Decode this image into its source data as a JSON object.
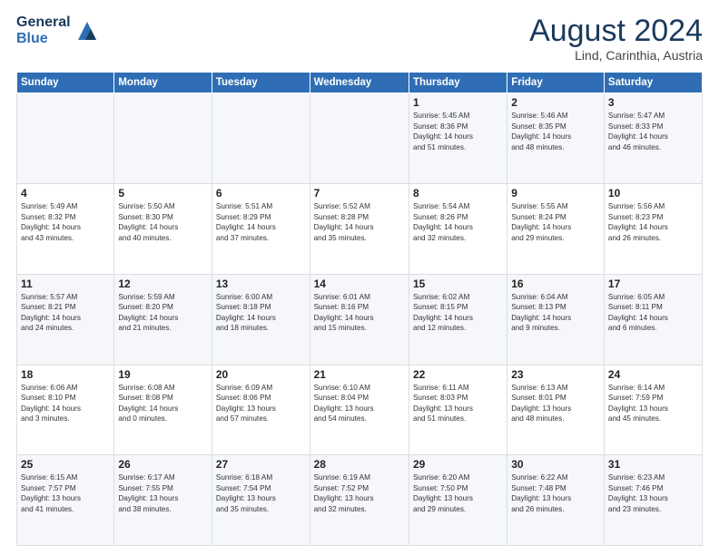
{
  "header": {
    "logo_line1": "General",
    "logo_line2": "Blue",
    "title": "August 2024",
    "subtitle": "Lind, Carinthia, Austria"
  },
  "weekdays": [
    "Sunday",
    "Monday",
    "Tuesday",
    "Wednesday",
    "Thursday",
    "Friday",
    "Saturday"
  ],
  "weeks": [
    [
      {
        "day": "",
        "content": ""
      },
      {
        "day": "",
        "content": ""
      },
      {
        "day": "",
        "content": ""
      },
      {
        "day": "",
        "content": ""
      },
      {
        "day": "1",
        "content": "Sunrise: 5:45 AM\nSunset: 8:36 PM\nDaylight: 14 hours\nand 51 minutes."
      },
      {
        "day": "2",
        "content": "Sunrise: 5:46 AM\nSunset: 8:35 PM\nDaylight: 14 hours\nand 48 minutes."
      },
      {
        "day": "3",
        "content": "Sunrise: 5:47 AM\nSunset: 8:33 PM\nDaylight: 14 hours\nand 46 minutes."
      }
    ],
    [
      {
        "day": "4",
        "content": "Sunrise: 5:49 AM\nSunset: 8:32 PM\nDaylight: 14 hours\nand 43 minutes."
      },
      {
        "day": "5",
        "content": "Sunrise: 5:50 AM\nSunset: 8:30 PM\nDaylight: 14 hours\nand 40 minutes."
      },
      {
        "day": "6",
        "content": "Sunrise: 5:51 AM\nSunset: 8:29 PM\nDaylight: 14 hours\nand 37 minutes."
      },
      {
        "day": "7",
        "content": "Sunrise: 5:52 AM\nSunset: 8:28 PM\nDaylight: 14 hours\nand 35 minutes."
      },
      {
        "day": "8",
        "content": "Sunrise: 5:54 AM\nSunset: 8:26 PM\nDaylight: 14 hours\nand 32 minutes."
      },
      {
        "day": "9",
        "content": "Sunrise: 5:55 AM\nSunset: 8:24 PM\nDaylight: 14 hours\nand 29 minutes."
      },
      {
        "day": "10",
        "content": "Sunrise: 5:56 AM\nSunset: 8:23 PM\nDaylight: 14 hours\nand 26 minutes."
      }
    ],
    [
      {
        "day": "11",
        "content": "Sunrise: 5:57 AM\nSunset: 8:21 PM\nDaylight: 14 hours\nand 24 minutes."
      },
      {
        "day": "12",
        "content": "Sunrise: 5:59 AM\nSunset: 8:20 PM\nDaylight: 14 hours\nand 21 minutes."
      },
      {
        "day": "13",
        "content": "Sunrise: 6:00 AM\nSunset: 8:18 PM\nDaylight: 14 hours\nand 18 minutes."
      },
      {
        "day": "14",
        "content": "Sunrise: 6:01 AM\nSunset: 8:16 PM\nDaylight: 14 hours\nand 15 minutes."
      },
      {
        "day": "15",
        "content": "Sunrise: 6:02 AM\nSunset: 8:15 PM\nDaylight: 14 hours\nand 12 minutes."
      },
      {
        "day": "16",
        "content": "Sunrise: 6:04 AM\nSunset: 8:13 PM\nDaylight: 14 hours\nand 9 minutes."
      },
      {
        "day": "17",
        "content": "Sunrise: 6:05 AM\nSunset: 8:11 PM\nDaylight: 14 hours\nand 6 minutes."
      }
    ],
    [
      {
        "day": "18",
        "content": "Sunrise: 6:06 AM\nSunset: 8:10 PM\nDaylight: 14 hours\nand 3 minutes."
      },
      {
        "day": "19",
        "content": "Sunrise: 6:08 AM\nSunset: 8:08 PM\nDaylight: 14 hours\nand 0 minutes."
      },
      {
        "day": "20",
        "content": "Sunrise: 6:09 AM\nSunset: 8:06 PM\nDaylight: 13 hours\nand 57 minutes."
      },
      {
        "day": "21",
        "content": "Sunrise: 6:10 AM\nSunset: 8:04 PM\nDaylight: 13 hours\nand 54 minutes."
      },
      {
        "day": "22",
        "content": "Sunrise: 6:11 AM\nSunset: 8:03 PM\nDaylight: 13 hours\nand 51 minutes."
      },
      {
        "day": "23",
        "content": "Sunrise: 6:13 AM\nSunset: 8:01 PM\nDaylight: 13 hours\nand 48 minutes."
      },
      {
        "day": "24",
        "content": "Sunrise: 6:14 AM\nSunset: 7:59 PM\nDaylight: 13 hours\nand 45 minutes."
      }
    ],
    [
      {
        "day": "25",
        "content": "Sunrise: 6:15 AM\nSunset: 7:57 PM\nDaylight: 13 hours\nand 41 minutes."
      },
      {
        "day": "26",
        "content": "Sunrise: 6:17 AM\nSunset: 7:55 PM\nDaylight: 13 hours\nand 38 minutes."
      },
      {
        "day": "27",
        "content": "Sunrise: 6:18 AM\nSunset: 7:54 PM\nDaylight: 13 hours\nand 35 minutes."
      },
      {
        "day": "28",
        "content": "Sunrise: 6:19 AM\nSunset: 7:52 PM\nDaylight: 13 hours\nand 32 minutes."
      },
      {
        "day": "29",
        "content": "Sunrise: 6:20 AM\nSunset: 7:50 PM\nDaylight: 13 hours\nand 29 minutes."
      },
      {
        "day": "30",
        "content": "Sunrise: 6:22 AM\nSunset: 7:48 PM\nDaylight: 13 hours\nand 26 minutes."
      },
      {
        "day": "31",
        "content": "Sunrise: 6:23 AM\nSunset: 7:46 PM\nDaylight: 13 hours\nand 23 minutes."
      }
    ]
  ]
}
